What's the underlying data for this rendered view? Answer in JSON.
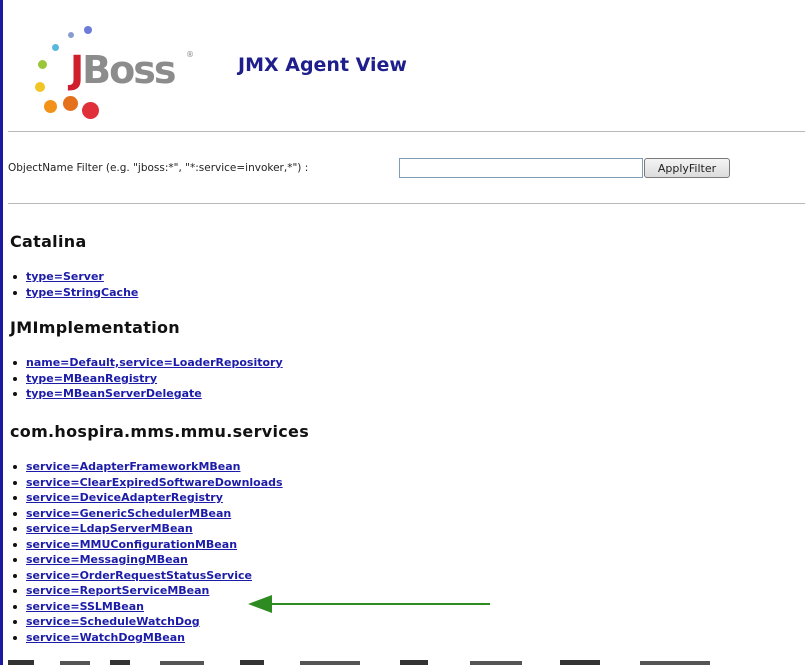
{
  "header": {
    "logo_text": "JBoss",
    "title": "JMX Agent View"
  },
  "filter": {
    "label": "ObjectName Filter (e.g. \"jboss:*\", \"*:service=invoker,*\") :",
    "value": "",
    "button_label": "ApplyFilter"
  },
  "domains": [
    {
      "name": "Catalina",
      "mbeans": [
        "type=Server",
        "type=StringCache"
      ]
    },
    {
      "name": "JMImplementation",
      "mbeans": [
        "name=Default,service=LoaderRepository",
        "type=MBeanRegistry",
        "type=MBeanServerDelegate"
      ]
    },
    {
      "name": "com.hospira.mms.mmu.services",
      "mbeans": [
        "service=AdapterFrameworkMBean",
        "service=ClearExpiredSoftwareDownloads",
        "service=DeviceAdapterRegistry",
        "service=GenericSchedulerMBean",
        "service=LdapServerMBean",
        "service=MMUConfigurationMBean",
        "service=MessagingMBean",
        "service=OrderRequestStatusService",
        "service=ReportServiceMBean",
        "service=SSLMBean",
        "service=ScheduleWatchDog",
        "service=WatchDogMBean"
      ]
    }
  ],
  "annotation": {
    "arrow_color": "#2e8b22",
    "points_to": "service=SSLMBean"
  },
  "colors": {
    "link": "#1c1ca8",
    "title": "#1e1e8c",
    "left_bar": "#1a1aa0"
  }
}
